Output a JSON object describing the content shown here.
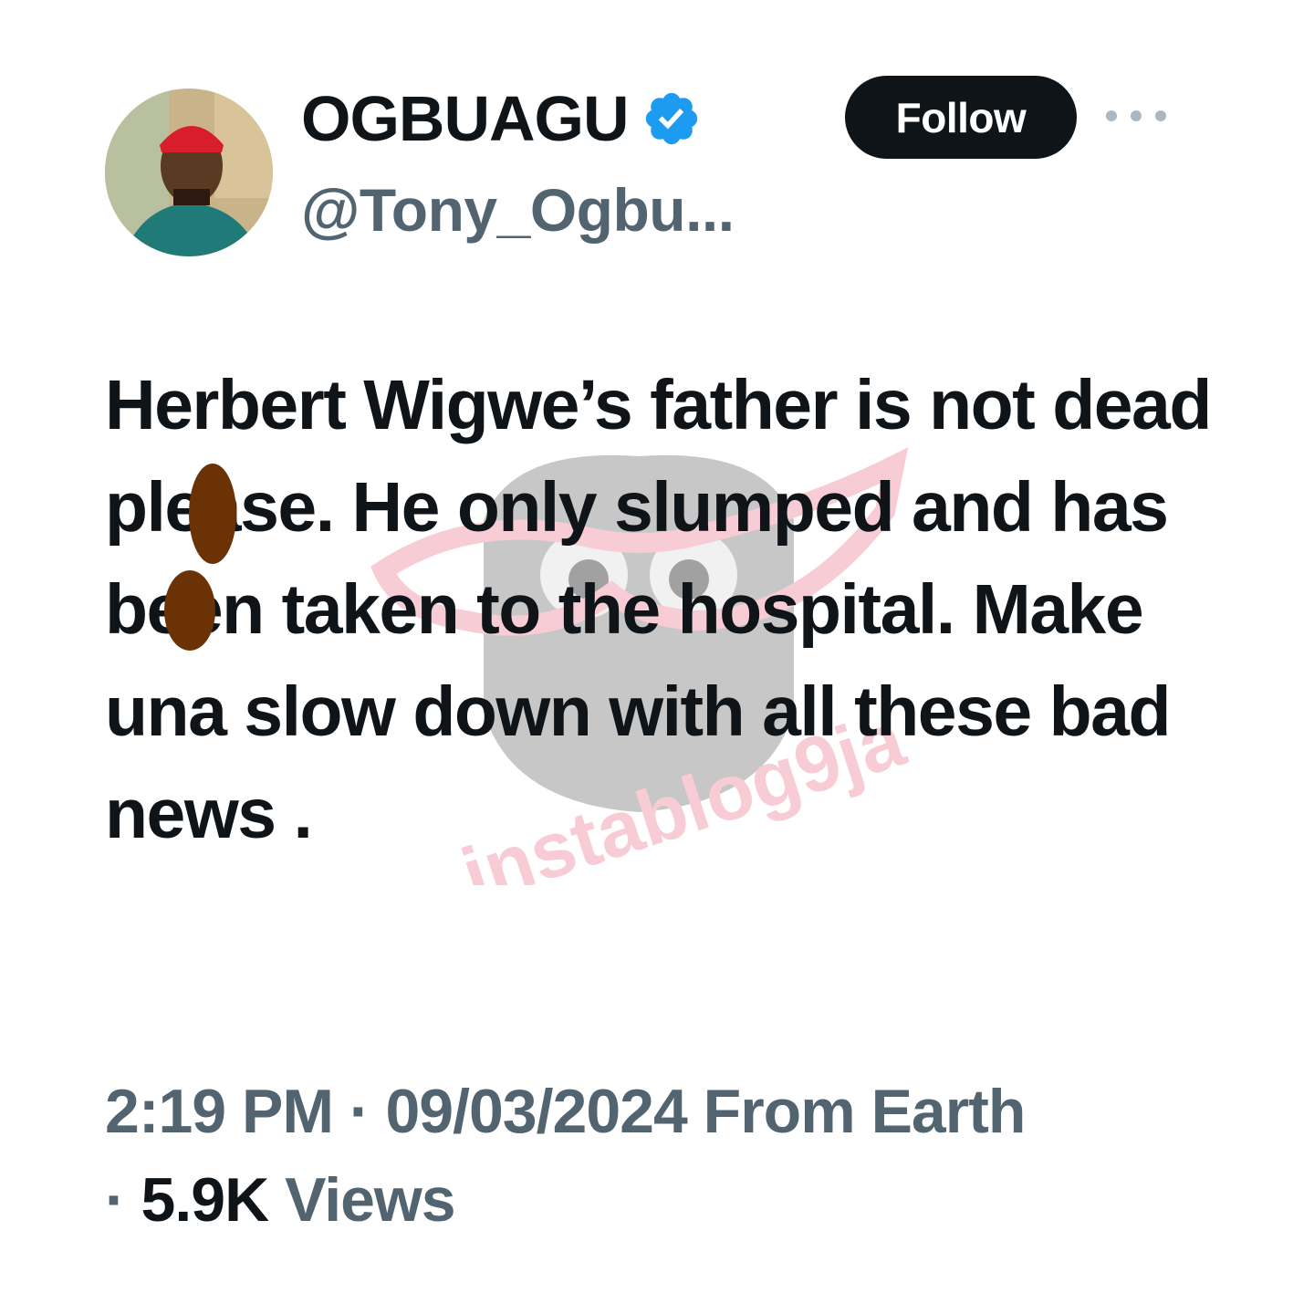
{
  "author": {
    "display_name": "OGBUAGU",
    "handle": "@Tony_Ogbu...",
    "verified_icon": "verified-badge-icon",
    "avatar_icon": "avatar"
  },
  "actions": {
    "follow_label": "Follow",
    "more_icon": "more-dots-icon"
  },
  "tweet": {
    "text": "Herbert Wigwe’s father is not dead please. He only slumped and has been taken to the hospital. Make una slow down with all these bad news ."
  },
  "watermark": {
    "text": "instablog9ja"
  },
  "meta": {
    "time": "2:19 PM",
    "sep1": " · ",
    "date": "09/03/2024",
    "source": " From Earth",
    "sep2": "· ",
    "views_count": "5.9K",
    "views_label": " Views"
  },
  "colors": {
    "text_primary": "#0f1419",
    "text_secondary": "#536471",
    "verified_blue": "#1d9bf0",
    "follow_bg": "#0f1419",
    "censor_brown": "#6b3206",
    "watermark_pink": "#f4a3b4"
  }
}
